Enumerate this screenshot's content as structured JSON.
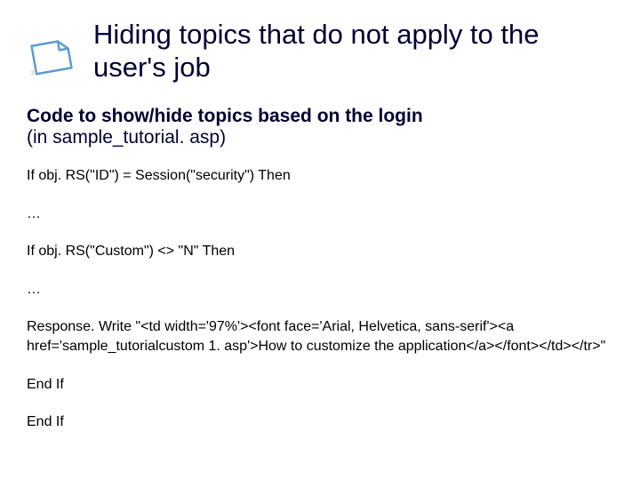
{
  "page_number": "2",
  "title": "Hiding topics that do not apply to the user's job",
  "subtitle_bold": "Code to show/hide topics based on the login",
  "subtitle_normal": "(in sample_tutorial. asp)",
  "code": {
    "line1": "If obj. RS(\"ID\") = Session(\"security\") Then",
    "line2": "…",
    "line3": "If obj. RS(\"Custom\") <> \"N\" Then",
    "line4": "…",
    "line5": "Response. Write \"<td width='97%'><font face='Arial, Helvetica, sans-serif'><a href='sample_tutorialcustom 1. asp'>How to customize the application</a></font></td></tr>\"",
    "line6": "End If",
    "line7": "End If"
  }
}
